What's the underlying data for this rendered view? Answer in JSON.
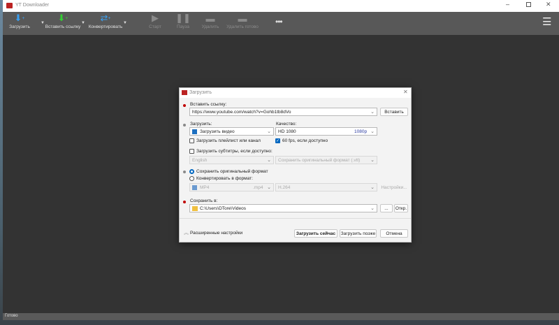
{
  "app": {
    "title": "YT Downloader",
    "status": "Готово"
  },
  "toolbar": {
    "download": "Загрузить",
    "paste_link": "Вставить ссылку",
    "convert": "Конвертировать",
    "start": "Старт",
    "pause": "Пауза",
    "delete": "Удалить",
    "delete_done": "Удалить готово"
  },
  "dialog": {
    "title": "Загрузить",
    "paste_label": "Вставить ссылку:",
    "url": "https://www.youtube.com/watch?v=Gohb1tb8dVo",
    "paste_button": "Вставить",
    "download_label": "Загрузить:",
    "download_type": "Загрузить видео",
    "quality_label": "Качество:",
    "quality": "HD 1080",
    "quality_badge": "1080p",
    "playlist_cb": "Загрузить плейлист или канал",
    "playlist_checked": false,
    "fps_cb": "60 fps, если доступно",
    "fps_checked": true,
    "subs_cb": "Загрузить субтитры, если доступно:",
    "subs_checked": false,
    "subs_lang": "English",
    "subs_format": "Сохранить оригинальный формат (.vtt)",
    "keep_format": "Сохранить оригинальный формат",
    "convert_format": "Конвертировать в формат:",
    "format": "MP4",
    "format_ext": ".mp4",
    "codec": "H.264",
    "settings_button": "Настройки...",
    "save_label": "Сохранить в:",
    "save_path": "C:\\Users\\DTore\\Videos",
    "browse_button": "...",
    "open_button": "Откр.",
    "advanced": "Расширенные настройки",
    "download_now": "Загрузить сейчас",
    "download_later": "Загрузить позже",
    "cancel": "Отмена",
    "colors": {
      "required": "#c00000",
      "optional": "#888888",
      "accent": "#0067c0"
    }
  }
}
